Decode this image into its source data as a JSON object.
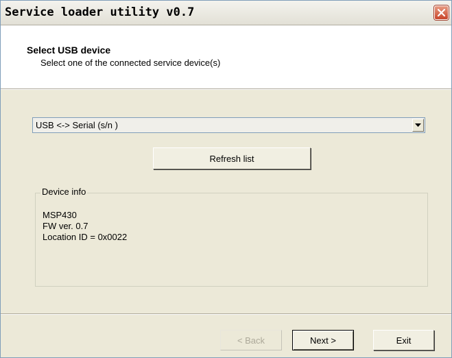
{
  "window": {
    "title": "Service loader utility v0.7"
  },
  "header": {
    "title": "Select USB device",
    "subtitle": "Select one of the connected service device(s)"
  },
  "device_select": {
    "selected": "USB <-> Serial (s/n )"
  },
  "buttons": {
    "refresh": "Refresh list",
    "back": "< Back",
    "next": "Next >",
    "exit": "Exit"
  },
  "device_info": {
    "legend": "Device info",
    "lines": [
      "MSP430",
      "FW ver. 0.7",
      "Location ID = 0x0022"
    ]
  },
  "icons": {
    "close": "close-icon",
    "dropdown": "chevron-down-icon"
  },
  "colors": {
    "close_button": "#c8442a",
    "window_bg": "#ece9d8"
  }
}
